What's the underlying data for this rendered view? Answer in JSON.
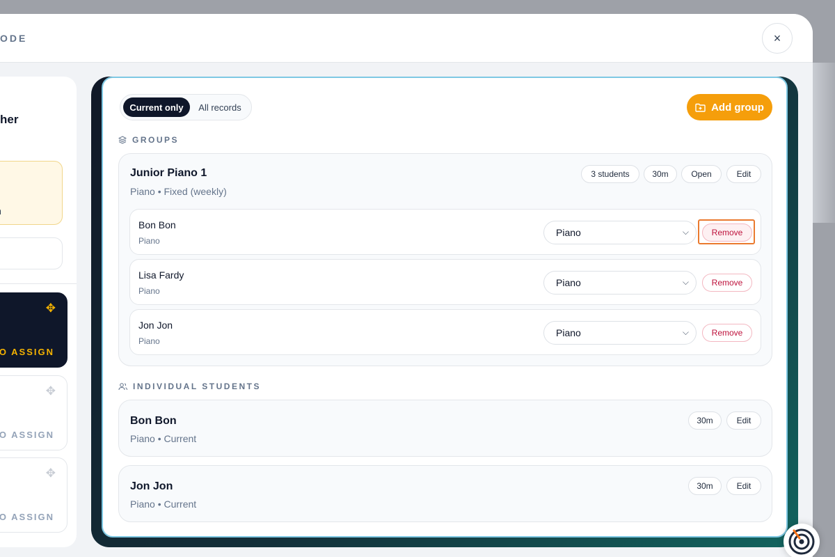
{
  "window": {
    "title": "ODE",
    "close_symbol": "×"
  },
  "left_panel": {
    "header_fragment": "her",
    "note_fragment": "in",
    "cards": [
      {
        "label": "TO ASSIGN",
        "active": true
      },
      {
        "label": "TO ASSIGN",
        "active": false
      },
      {
        "label": "TO ASSIGN",
        "active": false
      }
    ]
  },
  "filter": {
    "options": [
      "Current only",
      "All records"
    ],
    "selected": "Current only"
  },
  "toolbar": {
    "add_group_label": "Add group"
  },
  "groups_section": {
    "title": "GROUPS",
    "groups": [
      {
        "name": "Junior Piano 1",
        "subtitle": "Piano • Fixed (weekly)",
        "students_badge": "3 students",
        "duration_badge": "30m",
        "open_label": "Open",
        "edit_label": "Edit",
        "members": [
          {
            "name": "Bon Bon",
            "instrument": "Piano",
            "selected_instrument": "Piano",
            "remove_label": "Remove"
          },
          {
            "name": "Lisa Fardy",
            "instrument": "Piano",
            "selected_instrument": "Piano",
            "remove_label": "Remove"
          },
          {
            "name": "Jon Jon",
            "instrument": "Piano",
            "selected_instrument": "Piano",
            "remove_label": "Remove"
          }
        ]
      }
    ]
  },
  "individual_section": {
    "title": "INDIVIDUAL STUDENTS",
    "students": [
      {
        "name": "Bon Bon",
        "subtitle": "Piano • Current",
        "duration_badge": "30m",
        "edit_label": "Edit"
      },
      {
        "name": "Jon Jon",
        "subtitle": "Piano • Current",
        "duration_badge": "30m",
        "edit_label": "Edit"
      }
    ]
  },
  "colors": {
    "accent": "#f59e0b",
    "dark": "#0f172a",
    "remove_text": "#be123c",
    "highlight": "#ea7a2f",
    "card_border": "#7ec8e3"
  }
}
